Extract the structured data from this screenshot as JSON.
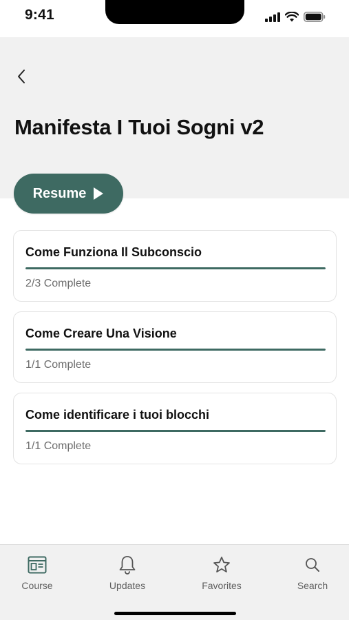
{
  "status_bar": {
    "time": "9:41"
  },
  "header": {
    "title": "Manifesta I Tuoi Sogni v2"
  },
  "resume_button": {
    "label": "Resume"
  },
  "lessons": [
    {
      "title": "Come Funziona Il Subconscio",
      "status": "2/3 Complete",
      "progress": 1.0
    },
    {
      "title": "Come Creare Una Visione",
      "status": "1/1 Complete",
      "progress": 1.0
    },
    {
      "title": "Come identificare i tuoi blocchi",
      "status": "1/1 Complete",
      "progress": 1.0
    }
  ],
  "tab_bar": {
    "tabs": [
      {
        "label": "Course",
        "icon": "course-icon",
        "active": true
      },
      {
        "label": "Updates",
        "icon": "bell-icon",
        "active": false
      },
      {
        "label": "Favorites",
        "icon": "star-icon",
        "active": false
      },
      {
        "label": "Search",
        "icon": "search-icon",
        "active": false
      }
    ]
  },
  "colors": {
    "accent": "#3e6a62",
    "header_bg": "#f1f1f1",
    "tab_bar_bg": "#f1f1f1",
    "muted_text": "#6d6d6d"
  }
}
